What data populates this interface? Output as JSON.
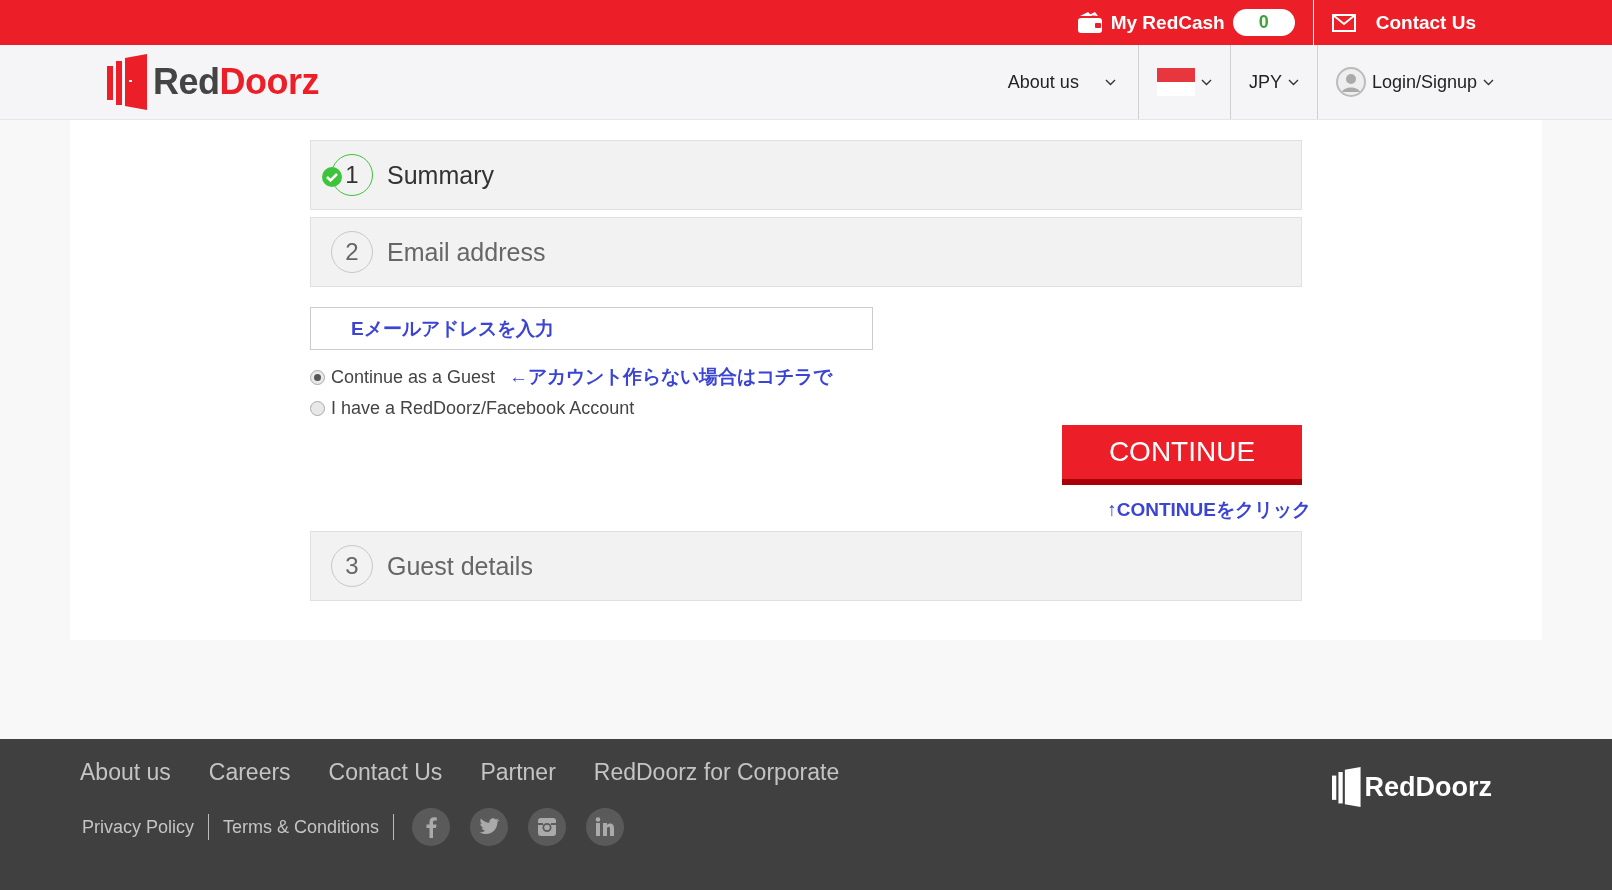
{
  "topbar": {
    "redcash_label": "My RedCash",
    "redcash_value": "0",
    "contact": "Contact Us"
  },
  "nav": {
    "logo": [
      {
        "text": "Red",
        "kind": "dark"
      },
      {
        "text": "Doorz",
        "kind": "accent"
      }
    ],
    "about": "About us",
    "currency": "JPY",
    "login": "Login/Signup"
  },
  "steps": [
    {
      "number": "1",
      "title": "Summary",
      "done": true
    },
    {
      "number": "2",
      "title": "Email address",
      "done": false
    }
  ],
  "email_field": {
    "placeholder": "Eメールアドレスを入力"
  },
  "options": [
    {
      "label": "Continue as a Guest",
      "selected": true,
      "note": "←アカウント作らない場合はコチラで"
    },
    {
      "label": "I have a RedDoorz/Facebook Account",
      "selected": false
    }
  ],
  "continue_button": "CONTINUE",
  "continue_note": "↑CONTINUEをクリック",
  "later_steps": [
    {
      "number": "3",
      "title": "Guest details",
      "done": false
    }
  ],
  "footer": {
    "links": [
      "About us",
      "Careers",
      "Contact Us",
      "Partner",
      "RedDoorz for Corporate"
    ],
    "legal": [
      "Privacy Policy",
      "Terms & Conditions"
    ],
    "logo": "RedDoorz"
  }
}
